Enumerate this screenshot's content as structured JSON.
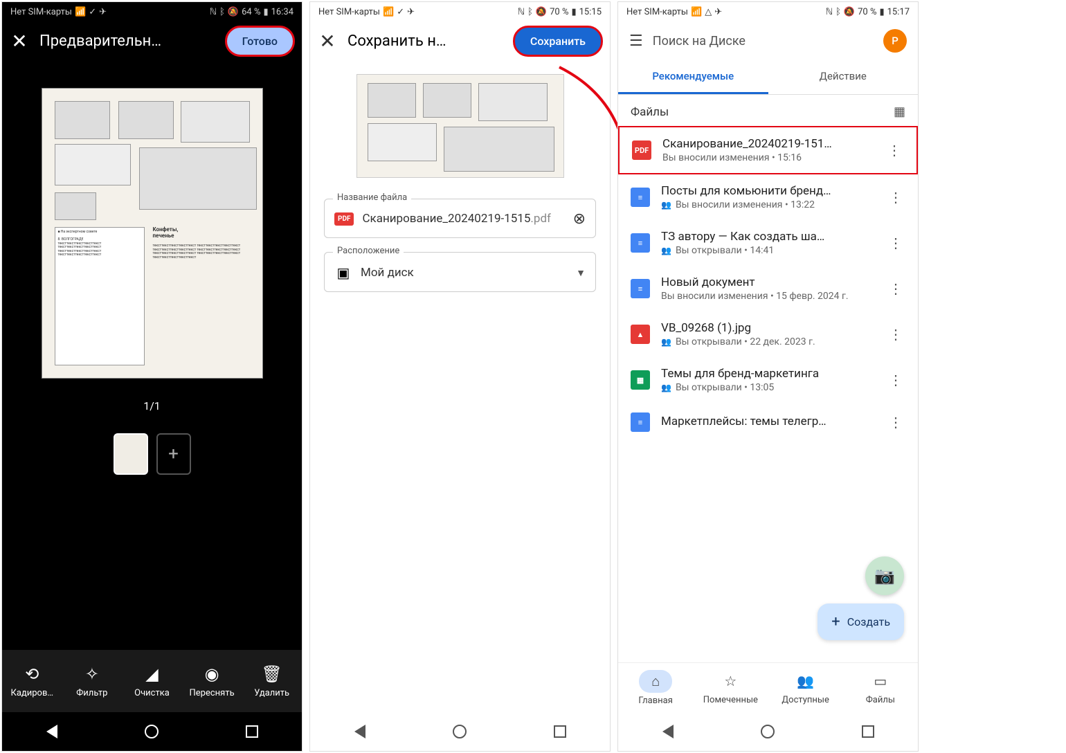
{
  "phone1": {
    "status": {
      "left": "Нет SIM-карты",
      "right": "64 %",
      "time": "16:34"
    },
    "title": "Предварительн…",
    "done": "Готово",
    "page_indicator": "1/1",
    "toolbar": {
      "crop": "Кадиров…",
      "filter": "Фильтр",
      "clean": "Очистка",
      "retake": "Переснять",
      "delete": "Удалить"
    }
  },
  "phone2": {
    "status": {
      "left": "Нет SIM-карты",
      "right": "70 %",
      "time": "15:15"
    },
    "title": "Сохранить н…",
    "save": "Сохранить",
    "field_name": {
      "label": "Название файла",
      "value": "Сканирование_20240219-1515",
      "ext": ".pdf"
    },
    "field_location": {
      "label": "Расположение",
      "value": "Мой диск"
    }
  },
  "phone3": {
    "status": {
      "left": "Нет SIM-карты",
      "right": "70 %",
      "time": "15:17"
    },
    "search": "Поиск на Диске",
    "avatar": "P",
    "tabs": {
      "recommended": "Рекомендуемые",
      "activity": "Действие"
    },
    "section_title": "Файлы",
    "files": [
      {
        "name": "Сканирование_20240219-151…",
        "meta": "Вы вносили изменения • 15:16",
        "type": "pdf",
        "shared": false,
        "highlight": true
      },
      {
        "name": "Посты для комьюнити бренд…",
        "meta": "Вы вносили изменения • 13:22",
        "type": "doc",
        "shared": true
      },
      {
        "name": "ТЗ автору — Как создать ша…",
        "meta": "Вы открывали • 14:41",
        "type": "doc",
        "shared": true
      },
      {
        "name": "Новый документ",
        "meta": "Вы вносили изменения • 15 февр. 2024 г.",
        "type": "doc",
        "shared": false
      },
      {
        "name": "VB_09268 (1).jpg",
        "meta": "Вы открывали • 22 дек. 2023 г.",
        "type": "img",
        "shared": true
      },
      {
        "name": "Темы для бренд-маркетинга",
        "meta": "Вы открывали • 13:05",
        "type": "sheet",
        "shared": true
      },
      {
        "name": "Маркетплейсы: темы телегр…",
        "meta": "",
        "type": "doc",
        "shared": false
      }
    ],
    "fab_create": "Создать",
    "bottomnav": {
      "home": "Главная",
      "starred": "Помеченные",
      "shared": "Доступные",
      "files": "Файлы"
    }
  }
}
